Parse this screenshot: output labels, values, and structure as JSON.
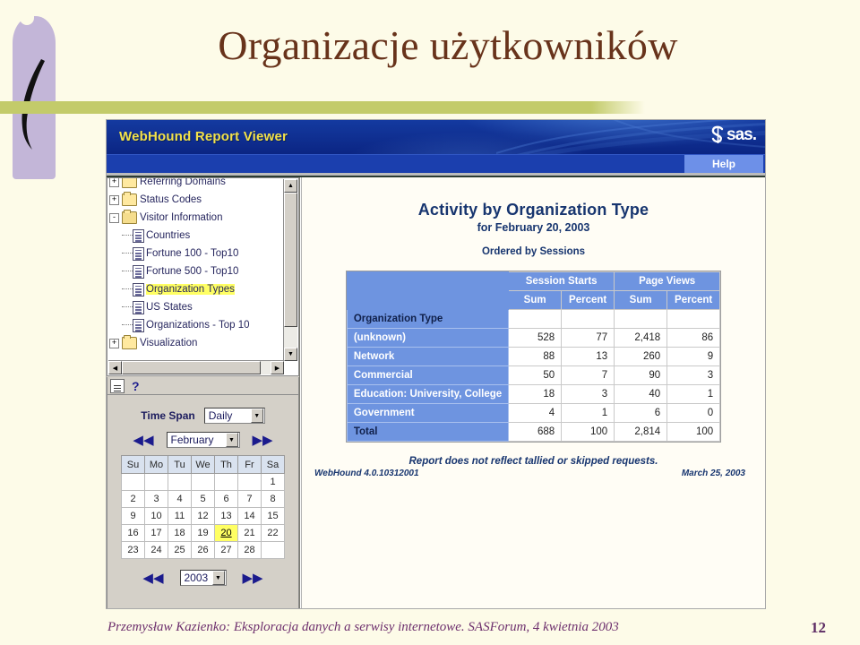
{
  "slide": {
    "title": "Organizacje użytkowników",
    "footer_text": "Przemysław Kazienko: Eksploracja danych a serwisy internetowe.  SASForum, 4 kwietnia 2003",
    "page_number": "12",
    "colors": {
      "background": "#fdfbe8",
      "title": "#68331b",
      "accent_bar": "#c3cb6a",
      "brush": "#c3b6d8",
      "footer": "#6d2f6d"
    }
  },
  "app": {
    "title": "WebHound Report Viewer",
    "brand": "sas.",
    "help_label": "Help",
    "colors": {
      "titlebar": "#0b2583",
      "title_text": "#f2e14a",
      "help_button": "#6d90e8",
      "table_header": "#6e94e0",
      "report_text": "#17356f",
      "highlight": "#ffff63"
    }
  },
  "tree": {
    "items": [
      {
        "label": "Referring Domains",
        "icon": "folder-icon",
        "toggle": "+",
        "depth": 0,
        "type": "folder",
        "selected": false,
        "partial": true
      },
      {
        "label": "Status Codes",
        "icon": "folder-icon",
        "toggle": "+",
        "depth": 0,
        "type": "folder",
        "selected": false
      },
      {
        "label": "Visitor Information",
        "icon": "folder-open-icon",
        "toggle": "-",
        "depth": 0,
        "type": "folder",
        "selected": false
      },
      {
        "label": "Countries",
        "icon": "document-icon",
        "toggle": "",
        "depth": 1,
        "type": "report",
        "selected": false
      },
      {
        "label": "Fortune 100 - Top10",
        "icon": "document-icon",
        "toggle": "",
        "depth": 1,
        "type": "report",
        "selected": false
      },
      {
        "label": "Fortune 500 - Top10",
        "icon": "document-icon",
        "toggle": "",
        "depth": 1,
        "type": "report",
        "selected": false
      },
      {
        "label": "Organization Types",
        "icon": "document-icon",
        "toggle": "",
        "depth": 1,
        "type": "report",
        "selected": true
      },
      {
        "label": "US States",
        "icon": "document-icon",
        "toggle": "",
        "depth": 1,
        "type": "report",
        "selected": false
      },
      {
        "label": "Organizations - Top 10",
        "icon": "document-icon",
        "toggle": "",
        "depth": 1,
        "type": "report",
        "selected": false
      },
      {
        "label": "Visualization",
        "icon": "folder-icon",
        "toggle": "+",
        "depth": 0,
        "type": "folder",
        "selected": false
      }
    ],
    "toolbar": {
      "list_icon": "list-icon",
      "help_icon": "?"
    }
  },
  "datepicker": {
    "time_span_label": "Time Span",
    "time_span_value": "Daily",
    "month_value": "February",
    "year_value": "2003",
    "prev_icon": "◀◀",
    "next_icon": "▶▶",
    "weekdays": [
      "Su",
      "Mo",
      "Tu",
      "We",
      "Th",
      "Fr",
      "Sa"
    ],
    "weeks": [
      [
        "",
        "",
        "",
        "",
        "",
        "",
        "1"
      ],
      [
        "2",
        "3",
        "4",
        "5",
        "6",
        "7",
        "8"
      ],
      [
        "9",
        "10",
        "11",
        "12",
        "13",
        "14",
        "15"
      ],
      [
        "16",
        "17",
        "18",
        "19",
        "20",
        "21",
        "22"
      ],
      [
        "23",
        "24",
        "25",
        "26",
        "27",
        "28",
        ""
      ]
    ],
    "selected_day": "20"
  },
  "report": {
    "title": "Activity by Organization Type",
    "subtitle": "for February 20, 2003",
    "ordering": "Ordered by Sessions",
    "note": "Report does not reflect tallied or skipped requests.",
    "product_version": "WebHound 4.0.10312001",
    "generated_date": "March 25, 2003"
  },
  "chart_data": {
    "type": "table",
    "title": "Activity by Organization Type",
    "subtitle": "for February 20, 2003",
    "ordering": "Ordered by Sessions",
    "group_headers": [
      "",
      "Session Starts",
      "Page Views"
    ],
    "columns": [
      "Organization Type",
      "Session Starts Sum",
      "Session Starts Percent",
      "Page Views Sum",
      "Page Views Percent"
    ],
    "sub_headers": [
      "Sum",
      "Percent",
      "Sum",
      "Percent"
    ],
    "row_header_label": "Organization Type",
    "categories": [
      "(unknown)",
      "Network",
      "Commercial",
      "Education: University, College",
      "Government"
    ],
    "series": [
      {
        "name": "Session Starts Sum",
        "values": [
          528,
          88,
          50,
          18,
          4
        ],
        "total": 688
      },
      {
        "name": "Session Starts Percent",
        "values": [
          77,
          13,
          7,
          3,
          1
        ],
        "total": 100
      },
      {
        "name": "Page Views Sum",
        "values": [
          "2,418",
          260,
          90,
          40,
          6
        ],
        "total": "2,814"
      },
      {
        "name": "Page Views Percent",
        "values": [
          86,
          9,
          3,
          1,
          0
        ],
        "total": 100
      }
    ],
    "total_label": "Total",
    "rows": [
      {
        "label": "Organization Type",
        "cells": [
          "",
          "",
          "",
          ""
        ],
        "is_header_row": true
      },
      {
        "label": "(unknown)",
        "cells": [
          "528",
          "77",
          "2,418",
          "86"
        ],
        "is_header_row": false
      },
      {
        "label": "Network",
        "cells": [
          "88",
          "13",
          "260",
          "9"
        ],
        "is_header_row": false
      },
      {
        "label": "Commercial",
        "cells": [
          "50",
          "7",
          "90",
          "3"
        ],
        "is_header_row": false
      },
      {
        "label": "Education: University, College",
        "cells": [
          "18",
          "3",
          "40",
          "1"
        ],
        "is_header_row": false
      },
      {
        "label": "Government",
        "cells": [
          "4",
          "1",
          "6",
          "0"
        ],
        "is_header_row": false
      },
      {
        "label": "Total",
        "cells": [
          "688",
          "100",
          "2,814",
          "100"
        ],
        "is_header_row": true
      }
    ]
  }
}
